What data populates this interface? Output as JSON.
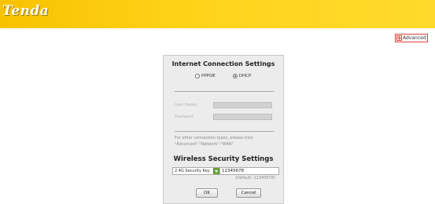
{
  "header": {
    "logo_text": "Tenda",
    "bg_color": "#ffd31a"
  },
  "advanced_button": {
    "label": "Advanced",
    "icon": "advanced-icon",
    "border_color": "#e0403a"
  },
  "internet": {
    "title": "Internet Connection Settings",
    "options": [
      {
        "label": "PPPOE",
        "selected": false
      },
      {
        "label": "DHCP",
        "selected": true
      }
    ],
    "user_name_label": "User Name:",
    "password_label": "Password:",
    "note": "For other connection types, please click \"Advanced\"-\"Network\"-\"WAN\"."
  },
  "wireless": {
    "title": "Wireless Security Settings",
    "select_value": "2.4G Security Key",
    "key_value": "12345678",
    "default_note": "(Default: 12345678)"
  },
  "buttons": {
    "ok": "OK",
    "cancel": "Cancel"
  }
}
